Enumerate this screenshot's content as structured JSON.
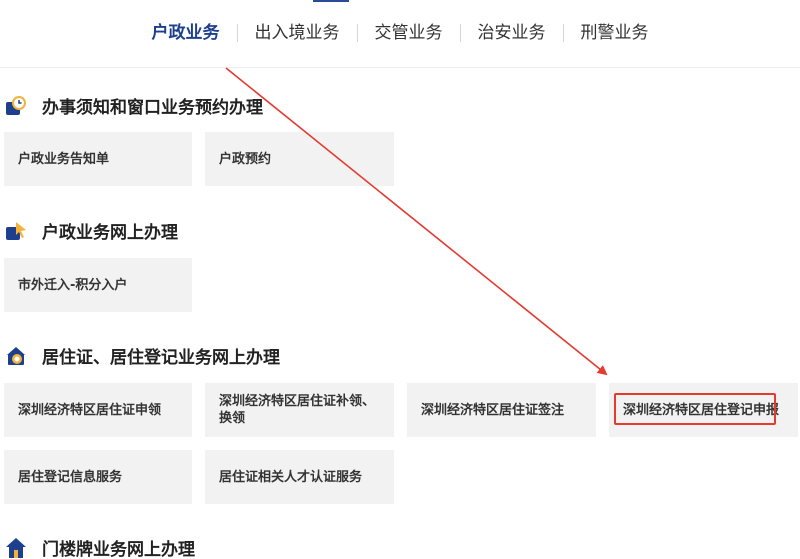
{
  "nav": {
    "tabs": [
      {
        "label": "户政业务",
        "active": true
      },
      {
        "label": "出入境业务",
        "active": false
      },
      {
        "label": "交管业务",
        "active": false
      },
      {
        "label": "治安业务",
        "active": false
      },
      {
        "label": "刑警业务",
        "active": false
      }
    ]
  },
  "sections": [
    {
      "title": "办事须知和窗口业务预约办理",
      "icon": "clock-icon",
      "items": [
        "户政业务告知单",
        "户政预约"
      ]
    },
    {
      "title": "户政业务网上办理",
      "icon": "cursor-icon",
      "items": [
        "市外迁入-积分入户"
      ]
    },
    {
      "title": "居住证、居住登记业务网上办理",
      "icon": "id-card-icon",
      "items": [
        "深圳经济特区居住证申领",
        "深圳经济特区居住证补领、换领",
        "深圳经济特区居住证签注",
        "深圳经济特区居住登记申报",
        "居住登记信息服务",
        "居住证相关人才认证服务"
      ]
    },
    {
      "title": "门楼牌业务网上办理",
      "icon": "house-icon",
      "items": []
    }
  ],
  "colors": {
    "accent": "#1e3f8e",
    "annotation_red": "#e53a2f",
    "card_bg": "#f2f2f2"
  }
}
